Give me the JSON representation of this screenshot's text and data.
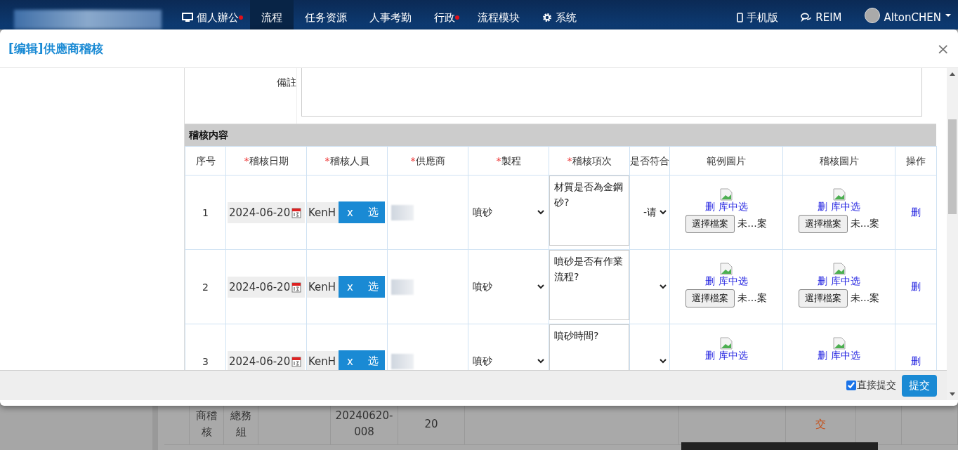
{
  "nav": {
    "items": [
      {
        "label": "個人辦公",
        "selected": false,
        "badge": true
      },
      {
        "label": "流程",
        "selected": true,
        "badge": false
      },
      {
        "label": "任务资源",
        "selected": false,
        "badge": false
      },
      {
        "label": "人事考勤",
        "selected": false,
        "badge": false
      },
      {
        "label": "行政",
        "selected": false,
        "badge": true
      },
      {
        "label": "流程模块",
        "selected": false,
        "badge": false
      },
      {
        "label": "系统",
        "selected": false,
        "badge": false
      }
    ],
    "right": [
      {
        "label": "手机版"
      },
      {
        "label": "REIM"
      }
    ],
    "user": "AltonCHEN"
  },
  "modal": {
    "title": "[编辑]供應商稽核",
    "close": "×"
  },
  "form": {
    "remarks_label": "備註"
  },
  "audit_table": {
    "title": "稽核内容",
    "columns": [
      {
        "label": "序号"
      },
      {
        "label": "稽核日期",
        "mark": "*"
      },
      {
        "label": "稽核人員",
        "mark": "*"
      },
      {
        "label": "供應商",
        "mark": "*"
      },
      {
        "label": "製程",
        "mark": "*"
      },
      {
        "label": "稽核項次",
        "mark": "*"
      },
      {
        "label": "是否符合"
      },
      {
        "label": "範例圖片"
      },
      {
        "label": "稽核圖片"
      },
      {
        "label": "操作"
      }
    ],
    "rows": [
      {
        "index": "1",
        "date": "2024-06-20",
        "person": "KenH",
        "clear": "x",
        "pick": "选",
        "process": "噴砂",
        "item": "材質是否為金鋼砂?",
        "compliance": "-请",
        "sample_image": {
          "delete": "删",
          "library": "库中选",
          "file_button": "選擇檔案",
          "file_status": "未...案"
        },
        "audit_image": {
          "delete": "删",
          "library": "库中选",
          "file_button": "選擇檔案",
          "file_status": "未...案"
        },
        "action": "删"
      },
      {
        "index": "2",
        "date": "2024-06-20",
        "person": "KenH",
        "clear": "x",
        "pick": "选",
        "process": "噴砂",
        "item": "噴砂是否有作業流程?",
        "sample_image": {
          "delete": "删",
          "library": "库中选",
          "file_button": "選擇檔案",
          "file_status": "未...案"
        },
        "audit_image": {
          "delete": "删",
          "library": "库中选",
          "file_button": "選擇檔案",
          "file_status": "未...案"
        },
        "action": "删"
      },
      {
        "index": "3",
        "date": "2024-06-20",
        "person": "KenH",
        "clear": "x",
        "pick": "选",
        "process": "噴砂",
        "item": "噴砂時間?",
        "sample_image": {
          "delete": "删",
          "library": "库中选"
        },
        "audit_image": {
          "delete": "删",
          "library": "库中选"
        },
        "action": "删"
      }
    ]
  },
  "footer": {
    "direct_submit": {
      "label": "直接提交",
      "checked": true
    },
    "submit": "提交"
  },
  "background_row": {
    "column_2": "商稽核",
    "column_3": "總務組",
    "column_5": "20240620-008",
    "column_6": "20",
    "column_9": "交"
  }
}
